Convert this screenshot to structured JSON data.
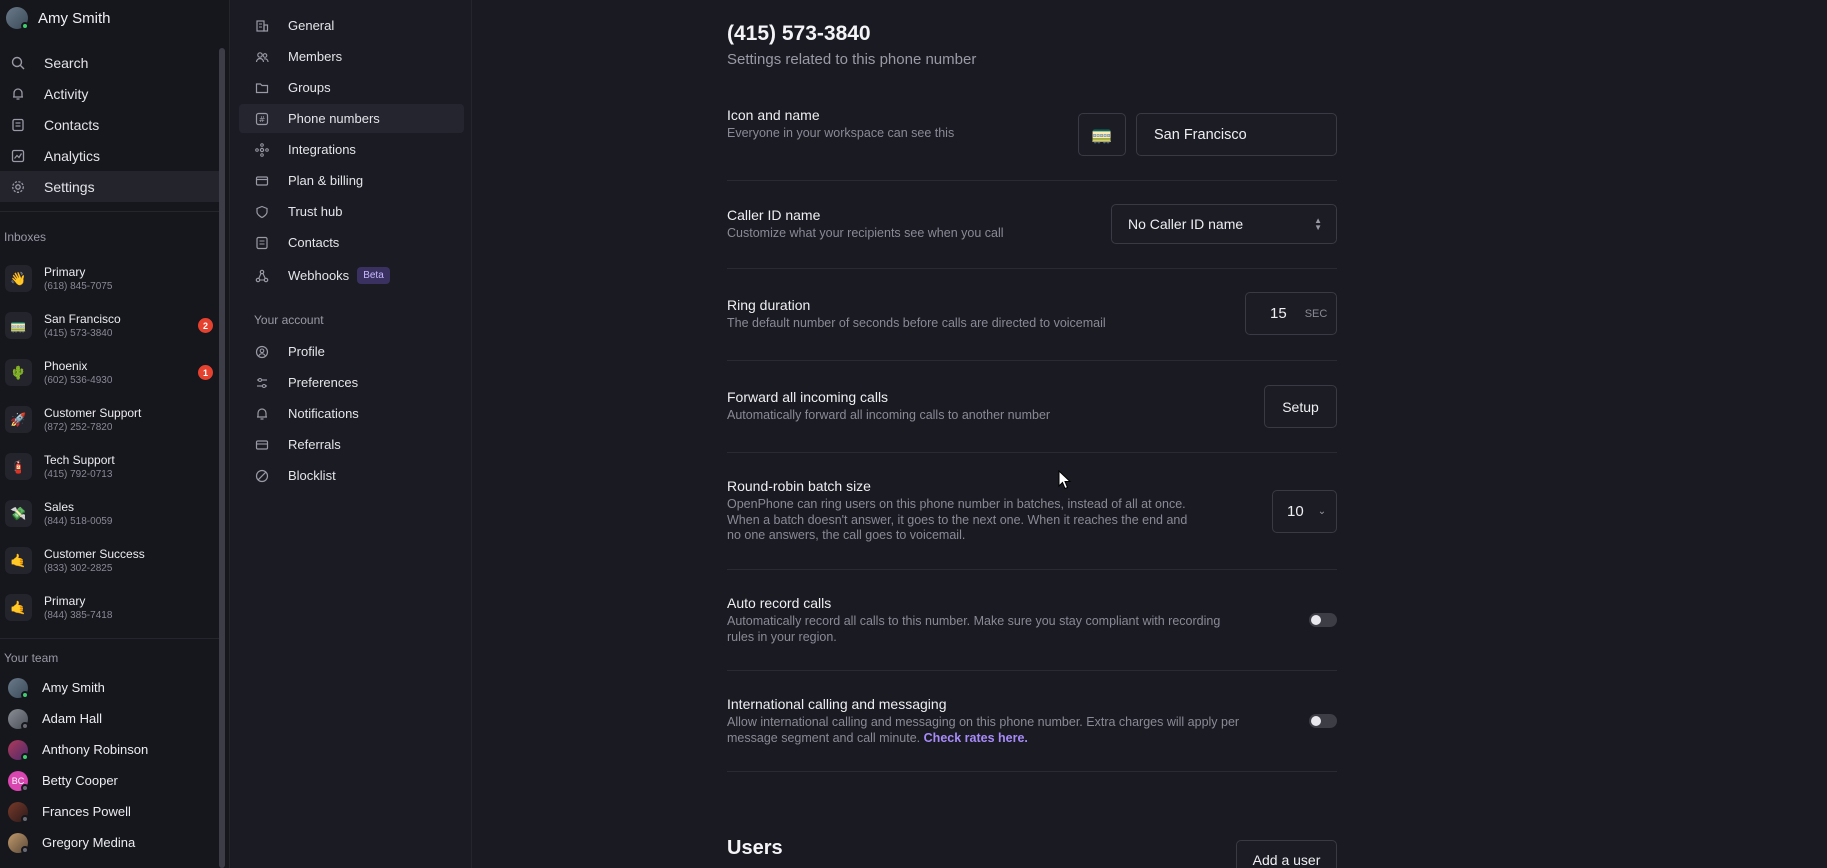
{
  "user": {
    "name": "Amy Smith"
  },
  "nav": {
    "search": "Search",
    "activity": "Activity",
    "contacts": "Contacts",
    "analytics": "Analytics",
    "settings": "Settings"
  },
  "inboxes": {
    "title": "Inboxes",
    "items": [
      {
        "emoji": "👋",
        "name": "Primary",
        "phone": "(618) 845-7075",
        "badge": ""
      },
      {
        "emoji": "🚃",
        "name": "San Francisco",
        "phone": "(415) 573-3840",
        "badge": "2"
      },
      {
        "emoji": "🌵",
        "name": "Phoenix",
        "phone": "(602) 536-4930",
        "badge": "1"
      },
      {
        "emoji": "🚀",
        "name": "Customer Support",
        "phone": "(872) 252-7820",
        "badge": ""
      },
      {
        "emoji": "🧯",
        "name": "Tech Support",
        "phone": "(415) 792-0713",
        "badge": ""
      },
      {
        "emoji": "💸",
        "name": "Sales",
        "phone": "(844) 518-0059",
        "badge": ""
      },
      {
        "emoji": "🤙",
        "name": "Customer Success",
        "phone": "(833) 302-2825",
        "badge": ""
      },
      {
        "emoji": "🤙",
        "name": "Primary",
        "phone": "(844) 385-7418",
        "badge": ""
      }
    ]
  },
  "team": {
    "title": "Your team",
    "members": [
      {
        "name": "Amy Smith",
        "initials": "",
        "online": true
      },
      {
        "name": "Adam Hall",
        "initials": "",
        "online": false
      },
      {
        "name": "Anthony Robinson",
        "initials": "",
        "online": true
      },
      {
        "name": "Betty Cooper",
        "initials": "BC",
        "online": false
      },
      {
        "name": "Frances Powell",
        "initials": "",
        "online": false
      },
      {
        "name": "Gregory Medina",
        "initials": "",
        "online": false
      }
    ]
  },
  "settings_nav": {
    "workspace": [
      "General",
      "Members",
      "Groups",
      "Phone numbers",
      "Integrations",
      "Plan & billing",
      "Trust hub",
      "Contacts",
      "Webhooks"
    ],
    "beta_label": "Beta",
    "account_title": "Your account",
    "account": [
      "Profile",
      "Preferences",
      "Notifications",
      "Referrals",
      "Blocklist"
    ]
  },
  "page": {
    "title": "(415) 573-3840",
    "subtitle": "Settings related to this phone number"
  },
  "settings": {
    "icon_name": {
      "title": "Icon and name",
      "desc": "Everyone in your workspace can see this",
      "icon": "🚃",
      "value": "San Francisco"
    },
    "caller_id": {
      "title": "Caller ID name",
      "desc": "Customize what your recipients see when you call",
      "value": "No Caller ID name"
    },
    "ring_duration": {
      "title": "Ring duration",
      "desc": "The default number of seconds before calls are directed to voicemail",
      "value": "15",
      "unit": "SEC"
    },
    "forward": {
      "title": "Forward all incoming calls",
      "desc": "Automatically forward all incoming calls to another number",
      "button": "Setup"
    },
    "round_robin": {
      "title": "Round-robin batch size",
      "desc_1": "OpenPhone can ring users on this phone number in batches, instead of all at once.",
      "desc_2": "When a batch doesn't answer, it goes to the next one. When it reaches the end and",
      "desc_3": "no one answers, the call goes to voicemail.",
      "value": "10"
    },
    "auto_record": {
      "title": "Auto record calls",
      "desc_1": "Automatically record all calls to this number. Make sure you stay compliant with recording",
      "desc_2": "rules in your region.",
      "enabled": false
    },
    "international": {
      "title": "International calling and messaging",
      "desc_1": "Allow international calling and messaging on this phone number. Extra charges will apply per",
      "desc_2": "message segment and call minute.",
      "link": "Check rates here.",
      "enabled": false
    }
  },
  "users": {
    "title": "Users",
    "add_button": "Add a user"
  },
  "colors": {
    "background": "#1a1a22",
    "sidebar": "#16161d",
    "accent_link": "#a78bfa",
    "badge": "#e5412f",
    "online": "#3ecf6e"
  }
}
